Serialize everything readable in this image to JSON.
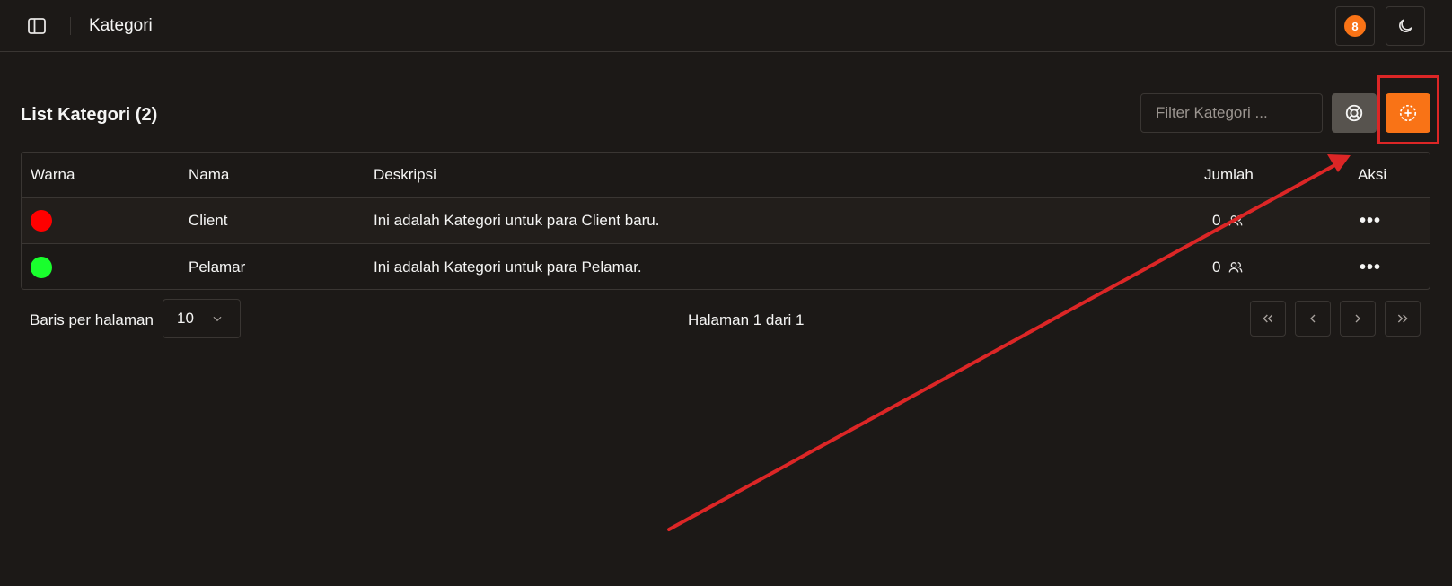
{
  "header": {
    "title": "Kategori",
    "notification_count": "8",
    "sidebar_toggle_icon": "sidebar-panel-icon",
    "theme_icon": "moon-icon"
  },
  "list": {
    "title": "List Kategori (2)",
    "filter_placeholder": "Filter Kategori ...",
    "reset_icon": "lifebuoy-icon",
    "add_icon": "plus-circle-icon"
  },
  "table": {
    "columns": [
      "Warna",
      "Nama",
      "Deskripsi",
      "Jumlah",
      "Aksi"
    ],
    "rows": [
      {
        "color": "#ff0000",
        "name": "Client",
        "description": "Ini adalah Kategori untuk para Client baru.",
        "count": "0",
        "actions": "•••"
      },
      {
        "color": "#19ff2d",
        "name": "Pelamar",
        "description": "Ini adalah Kategori untuk para Pelamar.",
        "count": "0",
        "actions": "•••"
      }
    ]
  },
  "pagination": {
    "rows_label": "Baris per halaman",
    "rows_per_page": "10",
    "page_info": "Halaman 1 dari 1"
  },
  "colors": {
    "background": "#1c1917",
    "accent": "#f97316",
    "annotation": "#dc2626",
    "border": "#3a3633"
  }
}
